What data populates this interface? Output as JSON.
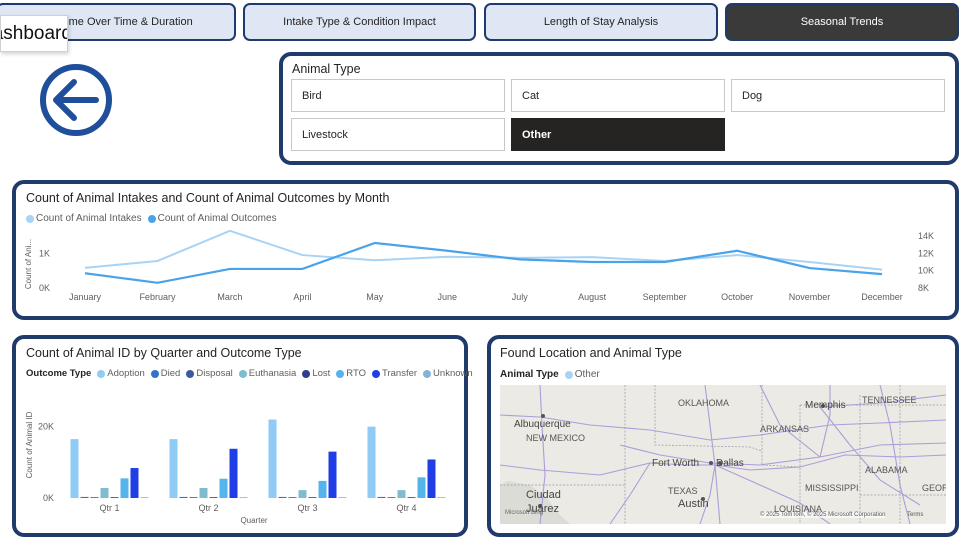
{
  "nav": {
    "tabs": [
      {
        "label": "Outcome Over Time & Duration"
      },
      {
        "label": "Intake Type & Condition Impact"
      },
      {
        "label": "Length of Stay Analysis"
      },
      {
        "label": "Seasonal Trends"
      }
    ],
    "tooltip": "Dashboard"
  },
  "slicer": {
    "title": "Animal Type",
    "options": [
      "Bird",
      "Cat",
      "Dog",
      "Livestock",
      "Other"
    ],
    "selected": "Other"
  },
  "line_chart": {
    "title": "Count of Animal Intakes and Count of Animal Outcomes by Month",
    "legend": [
      "Count of Animal Intakes",
      "Count of Animal Outcomes"
    ],
    "y_left_label": "Count of Ani...",
    "y_left_ticks": [
      "0K",
      "1K"
    ],
    "y_right_ticks": [
      "8K",
      "10K",
      "12K",
      "14K"
    ]
  },
  "bar_chart": {
    "title": "Count of Animal ID by Quarter and Outcome Type",
    "legend_title": "Outcome Type",
    "xlabel": "Quarter",
    "ylabel": "Count of Animal ID",
    "y_ticks": [
      "0K",
      "20K"
    ]
  },
  "map_panel": {
    "title": "Found Location and Animal Type",
    "legend_title": "Animal Type",
    "legend_item": "Other",
    "labels": [
      "OKLAHOMA",
      "Memphis",
      "TENNESSEE",
      "Albuquerque",
      "NEW MEXICO",
      "ARKANSAS",
      "Fort Worth",
      "Dallas",
      "ALABAMA",
      "MISSISSIPPI",
      "TEXAS",
      "Austin",
      "Ciudad Juárez",
      "LOUISIANA",
      "GEOR"
    ],
    "attribution": "© 2025 TomTom, © 2025 Microsoft Corporation",
    "terms": "Terms",
    "bing": "Microsoft Bing"
  },
  "colors": {
    "border": "#1f3a6b",
    "intakes": "#7dbbef",
    "outcomes": "#4aa3e8",
    "adoption": "#8fcbf5",
    "transfer": "#1f3ee6"
  },
  "chart_data": [
    {
      "type": "line",
      "title": "Count of Animal Intakes and Count of Animal Outcomes by Month",
      "x": [
        "January",
        "February",
        "March",
        "April",
        "May",
        "June",
        "July",
        "August",
        "September",
        "October",
        "November",
        "December"
      ],
      "ylabel": "Count of Ani...",
      "ylim_left": [
        0,
        1500
      ],
      "ylim_right": [
        8000,
        14000
      ],
      "series": [
        {
          "name": "Count of Animal Intakes",
          "axis": "left",
          "values": [
            580,
            780,
            1650,
            950,
            800,
            900,
            870,
            890,
            780,
            950,
            750,
            530
          ]
        },
        {
          "name": "Count of Animal Outcomes",
          "axis": "right",
          "values": [
            9700,
            8600,
            10200,
            10200,
            13200,
            12300,
            11300,
            11000,
            11000,
            12300,
            10300,
            9600
          ]
        }
      ],
      "legend": "top-left"
    },
    {
      "type": "bar",
      "title": "Count of Animal ID by Quarter and Outcome Type",
      "categories": [
        "Qtr 1",
        "Qtr 2",
        "Qtr 3",
        "Qtr 4"
      ],
      "xlabel": "Quarter",
      "ylabel": "Count of Animal ID",
      "ylim": [
        0,
        30000
      ],
      "series": [
        {
          "name": "Adoption",
          "color": "#8fcbf5",
          "values": [
            16500,
            16500,
            22000,
            20000
          ]
        },
        {
          "name": "Died",
          "color": "#2f74c8",
          "values": [
            300,
            300,
            300,
            300
          ]
        },
        {
          "name": "Disposal",
          "color": "#3c5b9a",
          "values": [
            200,
            200,
            200,
            200
          ]
        },
        {
          "name": "Euthanasia",
          "color": "#7fbcd0",
          "values": [
            2800,
            2800,
            2200,
            2200
          ]
        },
        {
          "name": "Lost",
          "color": "#2c3f8f",
          "values": [
            100,
            100,
            100,
            100
          ]
        },
        {
          "name": "RTO",
          "color": "#56b4ec",
          "values": [
            5500,
            5400,
            4800,
            5800
          ]
        },
        {
          "name": "Transfer",
          "color": "#1f3ee6",
          "values": [
            8400,
            13800,
            13000,
            10800
          ]
        },
        {
          "name": "Unknown",
          "color": "#86b3d4",
          "values": [
            100,
            100,
            100,
            100
          ]
        }
      ],
      "legend": "top"
    }
  ]
}
